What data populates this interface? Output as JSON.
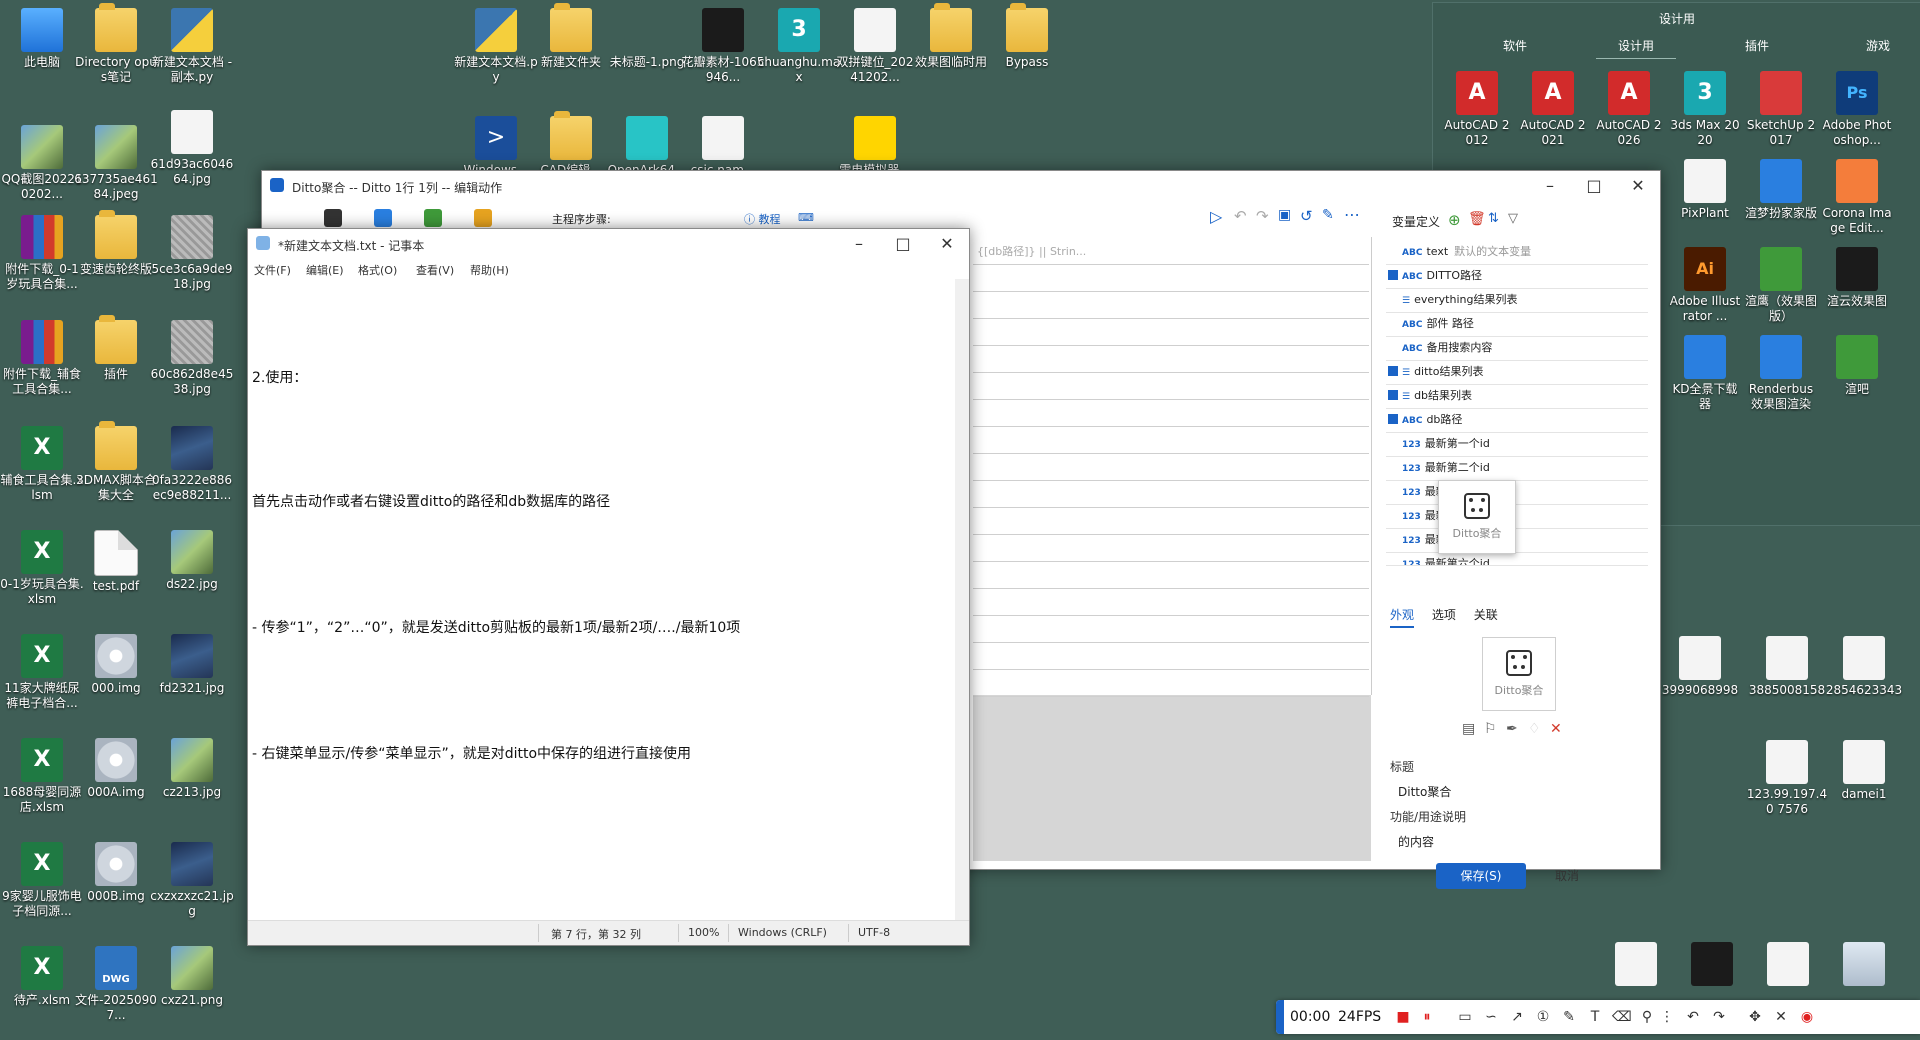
{
  "desktop": {
    "col1": [
      "此电脑",
      "QQ截图202210202...",
      "附件下载_0-1岁玩具合集...",
      "附件下载_辅食工具合集...",
      "辅食工具合集.xlsm",
      "0-1岁玩具合集.xlsm",
      "11家大牌纸尿裤电子档合...",
      "1688母婴同源店.xlsm",
      "9家婴儿服饰电子档同源...",
      "待产.xlsm"
    ],
    "col2": [
      "Directory opus笔记",
      "637735ae46184.jpeg",
      "变速齿轮终版",
      "插件",
      "3DMAX脚本合集大全",
      "test.pdf",
      "000.img",
      "000A.img",
      "000B.img",
      "文件-20250907..."
    ],
    "col3": [
      "新建文本文档 - 副本.py",
      "61d93ac604664.jpg",
      "5ce3c6a9de918.jpg",
      "60c862d8e4538.jpg",
      "0fa3222e886ec9e88211...",
      "ds22.jpg",
      "fd2321.jpg",
      "cz213.jpg",
      "cxzxzxzc21.jpg",
      "cxz21.png"
    ],
    "top_row": [
      "新建文本文档.py",
      "新建文件夹",
      "未标题-1.png",
      "花瓣素材-1065946...",
      "chuanghu.max",
      "双拼键位_20241202...",
      "效果图临时用",
      "Bypass"
    ],
    "second_row": [
      "Windows...",
      "CAD编辑...",
      "OpenArk64...",
      "csic.nam...",
      "雷电模拟器..."
    ],
    "right_files": [
      "3999068998",
      "3885008158",
      "2854623343",
      "123.99.197.40 7576",
      "damei1"
    ]
  },
  "group_panel": {
    "title": "设计用",
    "tabs": [
      "软件",
      "设计用",
      "插件",
      "游戏"
    ],
    "apps": [
      "AutoCAD 2012",
      "AutoCAD 2021",
      "AutoCAD 2026",
      "3ds Max 2020",
      "SketchUp 2017",
      "Adobe Photoshop...",
      "PixPlant",
      "渲梦扮家家版",
      "Corona Image Edit...",
      "Adobe Illustrator ...",
      "渲鹰（效果图版）",
      "渲云效果图",
      "KD全景下载器",
      "Renderbus效果图渲染",
      "渲吧"
    ]
  },
  "ditto": {
    "title": "Ditto聚合 -- Ditto 1行 1列 -- 编辑动作",
    "main_steps_label": "主程序步骤:",
    "tutorial": "教程",
    "placeholder": "{[db路径]} || Strin...",
    "var_header": "变量定义",
    "vars": [
      {
        "type": "ABC",
        "name": "text",
        "hint": "默认的文本变量",
        "save": false
      },
      {
        "type": "ABC",
        "name": "DITTO路径",
        "hint": "",
        "save": true
      },
      {
        "type": "☰",
        "name": "everything结果列表",
        "hint": "",
        "save": false
      },
      {
        "type": "ABC",
        "name": "部件 路径",
        "hint": "",
        "save": false
      },
      {
        "type": "ABC",
        "name": "备用搜索内容",
        "hint": "",
        "save": false
      },
      {
        "type": "☰",
        "name": "ditto结果列表",
        "hint": "",
        "save": true
      },
      {
        "type": "☰",
        "name": "db结果列表",
        "hint": "",
        "save": true
      },
      {
        "type": "ABC",
        "name": "db路径",
        "hint": "",
        "save": true
      },
      {
        "type": "123",
        "name": "最新第一个id",
        "hint": "",
        "save": false
      },
      {
        "type": "123",
        "name": "最新第二个id",
        "hint": "",
        "save": false
      },
      {
        "type": "123",
        "name": "最新...",
        "hint": "",
        "save": false
      },
      {
        "type": "123",
        "name": "最新...",
        "hint": "",
        "save": false
      },
      {
        "type": "123",
        "name": "最新...",
        "hint": "",
        "save": false
      },
      {
        "type": "123",
        "name": "最新第六个id",
        "hint": "",
        "save": false
      }
    ],
    "sub_tabs": [
      "外观",
      "选项",
      "关联"
    ],
    "preview_label": "Ditto聚合",
    "field_title_label": "标题",
    "field_title_value": "Ditto聚合",
    "field_desc_label": "功能/用途说明",
    "field_desc_value": "的内容",
    "save_button": "保存(S)",
    "cancel_button": "取消"
  },
  "notepad": {
    "title": "*新建文本文档.txt - 记事本",
    "menu": [
      "文件(F)",
      "编辑(E)",
      "格式(O)",
      "查看(V)",
      "帮助(H)"
    ],
    "lines": [
      "2.使用：",
      "首先点击动作或者右键设置ditto的路径和db数据库的路径",
      "- 传参“1”，“2”…“0”，就是发送ditto剪贴板的最新1项/最新2项/…./最新10项",
      "- 右键菜单显示/传参“菜单显示”，就是对ditto中保存的组进行直接使用"
    ],
    "status": {
      "position": "第 7 行，第 32 列",
      "zoom": "100%",
      "eol": "Windows (CRLF)",
      "encoding": "UTF-8"
    }
  },
  "drag_preview_label": "Ditto聚合",
  "recorder": {
    "time": "00:00",
    "fps": "24FPS"
  }
}
